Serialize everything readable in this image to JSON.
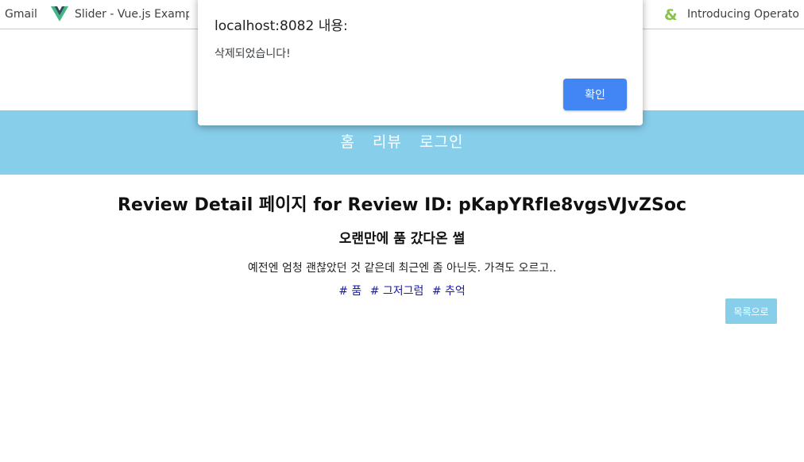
{
  "bookmarks": [
    {
      "label": "Gmail",
      "icon": "gmail-icon"
    },
    {
      "label": "Slider - Vue.js Examp",
      "icon": "vue-icon"
    },
    {
      "label": "Introducing Operato",
      "icon": "ampersand-icon"
    }
  ],
  "nav": {
    "background": "#87ceeb",
    "links": [
      "홈",
      "리뷰",
      "로그인"
    ]
  },
  "content": {
    "page_title": "Review Detail 페이지 for Review ID: pKapYRfIe8vgsVJvZSoc",
    "review_title": "오랜만에 품 갔다온 썰",
    "review_body": "예전엔 엄청 괜찮았던 것 같은데 최근엔 좀 아닌듯. 가격도 오르고..",
    "tags": [
      "# 품",
      "# 그저그럼",
      "# 추억"
    ],
    "back_button": "목록으로"
  },
  "dialog": {
    "origin": "localhost:8082 내용:",
    "message": "삭제되었습니다!",
    "ok_button": "확인",
    "ok_color": "#4285f4"
  }
}
